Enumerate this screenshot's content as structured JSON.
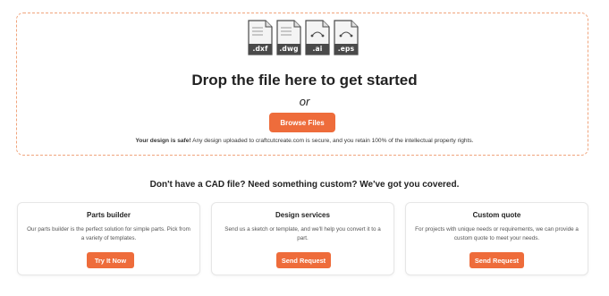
{
  "upload": {
    "file_types": [
      {
        "ext": ".dxf",
        "icon": "dxf-file-icon"
      },
      {
        "ext": ".dwg",
        "icon": "dwg-file-icon"
      },
      {
        "ext": ".ai",
        "icon": "ai-file-icon"
      },
      {
        "ext": ".eps",
        "icon": "eps-file-icon"
      }
    ],
    "title": "Drop the file here to get started",
    "or_text": "or",
    "browse_label": "Browse Files",
    "safe_bold": "Your design is safe!",
    "safe_text": " Any design uploaded to craftcutcreate.com is secure, and you retain 100% of the intellectual property rights."
  },
  "custom": {
    "heading": "Don't have a CAD file? Need something custom? We've got you covered."
  },
  "cards": [
    {
      "title": "Parts builder",
      "description": "Our parts builder is the perfect solution for simple parts. Pick from a variety of templates.",
      "button": "Try It Now"
    },
    {
      "title": "Design services",
      "description": "Send us a sketch or template, and we'll help you convert it to a part.",
      "button": "Send Request"
    },
    {
      "title": "Custom quote",
      "description": "For projects with unique needs or requirements, we can provide a custom quote to meet your needs.",
      "button": "Send Request"
    }
  ],
  "colors": {
    "accent": "#ee6c3b",
    "dashed_border": "#f0a47c",
    "file_icon": "#4a4a4a"
  }
}
